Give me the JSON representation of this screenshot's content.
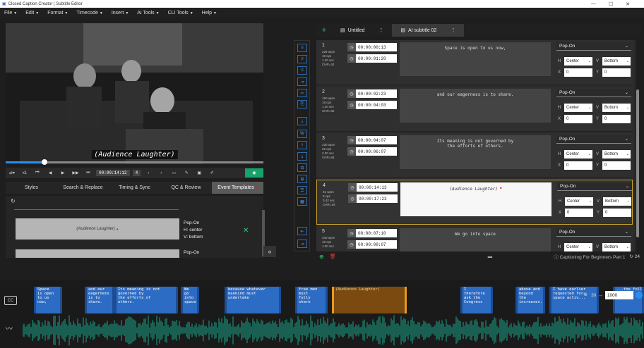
{
  "window": {
    "title": "Closed Caption Creator | Subtitle Editor"
  },
  "menu": [
    {
      "label": "File"
    },
    {
      "label": "Edit"
    },
    {
      "label": "Format"
    },
    {
      "label": "Timecode"
    },
    {
      "label": "Insert"
    },
    {
      "label": "Ai Tools"
    },
    {
      "label": "CLI Tools"
    },
    {
      "label": "Help"
    }
  ],
  "player": {
    "caption_overlay": "(Audience Laughter)",
    "progress": 0.15,
    "speed": "x1",
    "timecode": "00:00:14:12",
    "frame_step": "4"
  },
  "left_tabs": [
    {
      "label": "Styles"
    },
    {
      "label": "Search & Replace"
    },
    {
      "label": "Timing & Sync"
    },
    {
      "label": "QC & Review"
    },
    {
      "label": "Event Templates",
      "active": true
    }
  ],
  "templates": [
    {
      "text": "(Audience Laughter)",
      "mode": "Pop-On",
      "h": "H: center",
      "v": "V: bottom"
    },
    {
      "text": "",
      "mode": "Pop-On"
    }
  ],
  "doc_tabs": [
    {
      "label": "Untitled"
    },
    {
      "label": "AI subtitle 02",
      "active": true
    }
  ],
  "events": [
    {
      "num": "1",
      "stats": [
        "228 wpm",
        "19 cps",
        "1.20 sec",
        "CHR=34"
      ],
      "start": "00:00:00:13",
      "end": "00:00:01:20",
      "text": "Space is open to us now,",
      "mode": "Pop-On",
      "h": "Center",
      "v": "Bottom",
      "x": "0",
      "y": "0"
    },
    {
      "num": "2",
      "stats": [
        "150 wpm",
        "19 cps",
        "1.20 sec",
        "CHR=30"
      ],
      "start": "00:00:02:23",
      "end": "00:00:04:03",
      "text": "and our eagerness is to share.",
      "mode": "Pop-On",
      "h": "Center",
      "v": "Bottom",
      "x": "0",
      "y": "0"
    },
    {
      "num": "3",
      "stats": [
        "230 wpm",
        "26 cps",
        "2.00 sec",
        "CHR=58"
      ],
      "start": "00:00:04:07",
      "end": "00:00:06:07",
      "text": "Its meaning is not governed by\nthe efforts of others.",
      "mode": "Pop-On",
      "h": "Center",
      "v": "Bottom",
      "x": "0",
      "y": "0"
    },
    {
      "num": "4",
      "stats": [
        "31 wpm",
        "9 cps",
        "3.42 sec",
        "CHR=19"
      ],
      "start": "00:00:14:13",
      "end": "00:00:17:23",
      "text": "(Audience Laughter)",
      "mode": "Pop-On",
      "h": "Center",
      "v": "Bottom",
      "x": "0",
      "y": "0",
      "selected": true
    },
    {
      "num": "5",
      "stats": [
        "340 wpm",
        "18 cps",
        "1.00 sec"
      ],
      "start": "00:00:07:10",
      "end": "00:00:08:07",
      "text": "We go into space",
      "mode": "Pop-On",
      "h": "Center",
      "v": "Bottom",
      "x": "0",
      "y": "0"
    }
  ],
  "footer": {
    "project": "Captioning For Beginners Part 1",
    "count": "24"
  },
  "timeline": {
    "cc_label": "CC",
    "zoom_value": "30",
    "zoom_input": "1000",
    "clips": [
      {
        "text": "Space\nis open\nto us\nnow,"
      },
      {
        "text": "and our\neagerness\nis to\nshare."
      },
      {
        "text": "Its meaning is not\ngoverned by\nthe efforts of\nothers."
      },
      {
        "text": "We\ngo\ninto\nspace"
      },
      {
        "text": "because whatever\nmankind must\nundertake"
      },
      {
        "text": "free men\nmust\nfully\nshare"
      },
      {
        "text": "(Audience Laughter)",
        "selected": true
      },
      {
        "text": "I\ntherefore\nask the\nCongress"
      },
      {
        "text": "above and\nbeyond\nthe\nincreases."
      },
      {
        "text": "I have earlier\nrequested for\nspace activ..."
      },
      {
        "text": "...the followin"
      }
    ]
  },
  "colors": {
    "accent": "#2d8cf0",
    "green": "#16a36a",
    "selected_border": "#c9a227",
    "clip_blue": "#2d6cc4",
    "wave": "#1aa58a"
  }
}
